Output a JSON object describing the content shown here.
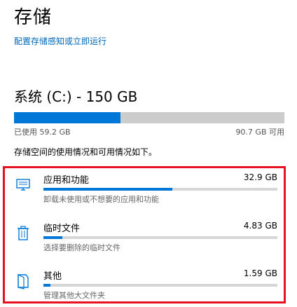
{
  "page_title": "存储",
  "config_link": "配置存储感知或立即运行",
  "drive": {
    "title": "系统 (C:) - 150 GB",
    "used_label": "已使用 59.2 GB",
    "free_label": "90.7 GB 可用",
    "used_fraction": 0.395
  },
  "description": "存储空间的使用情况和可用情况如下。",
  "categories": [
    {
      "name": "应用和功能",
      "size": "32.9 GB",
      "subtitle": "卸载未使用或不想要的应用和功能",
      "fraction": 0.55,
      "icon": "monitor-icon"
    },
    {
      "name": "临时文件",
      "size": "4.83 GB",
      "subtitle": "选择要删除的临时文件",
      "fraction": 0.08,
      "icon": "trash-icon"
    },
    {
      "name": "其他",
      "size": "1.59 GB",
      "subtitle": "管理其他大文件夹",
      "fraction": 0.03,
      "icon": "folder-icon"
    }
  ],
  "colors": {
    "accent": "#0078d7",
    "highlight": "#e81123",
    "link": "#0067b8"
  }
}
